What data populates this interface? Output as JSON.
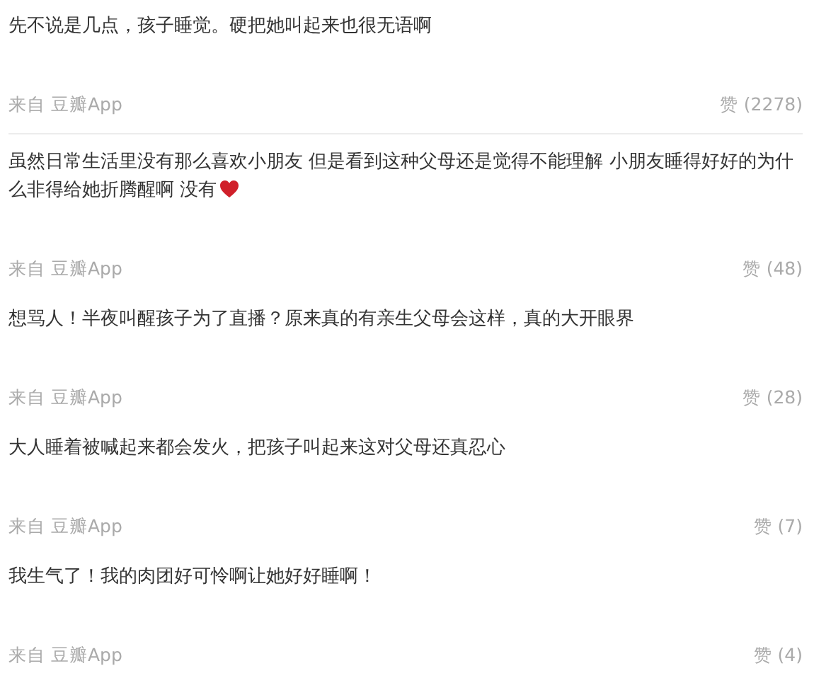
{
  "comments": [
    {
      "text": "先不说是几点，孩子睡觉。硬把她叫起来也很无语啊",
      "heart": false,
      "source": "来自 豆瓣App",
      "likes": "赞 (2278)",
      "divider": true
    },
    {
      "text": "虽然日常生活里没有那么喜欢小朋友 但是看到这种父母还是觉得不能理解 小朋友睡得好好的为什么非得给她折腾醒啊 没有",
      "heart": true,
      "source": "来自 豆瓣App",
      "likes": "赞 (48)",
      "divider": false
    },
    {
      "text": "想骂人！半夜叫醒孩子为了直播？原来真的有亲生父母会这样，真的大开眼界",
      "heart": false,
      "source": "来自 豆瓣App",
      "likes": "赞 (28)",
      "divider": false
    },
    {
      "text": "大人睡着被喊起来都会发火，把孩子叫起来这对父母还真忍心",
      "heart": false,
      "source": "来自 豆瓣App",
      "likes": "赞 (7)",
      "divider": false
    },
    {
      "text": "我生气了！我的肉团好可怜啊让她好好睡啊！",
      "heart": false,
      "source": "来自 豆瓣App",
      "likes": "赞 (4)",
      "divider": false
    }
  ]
}
